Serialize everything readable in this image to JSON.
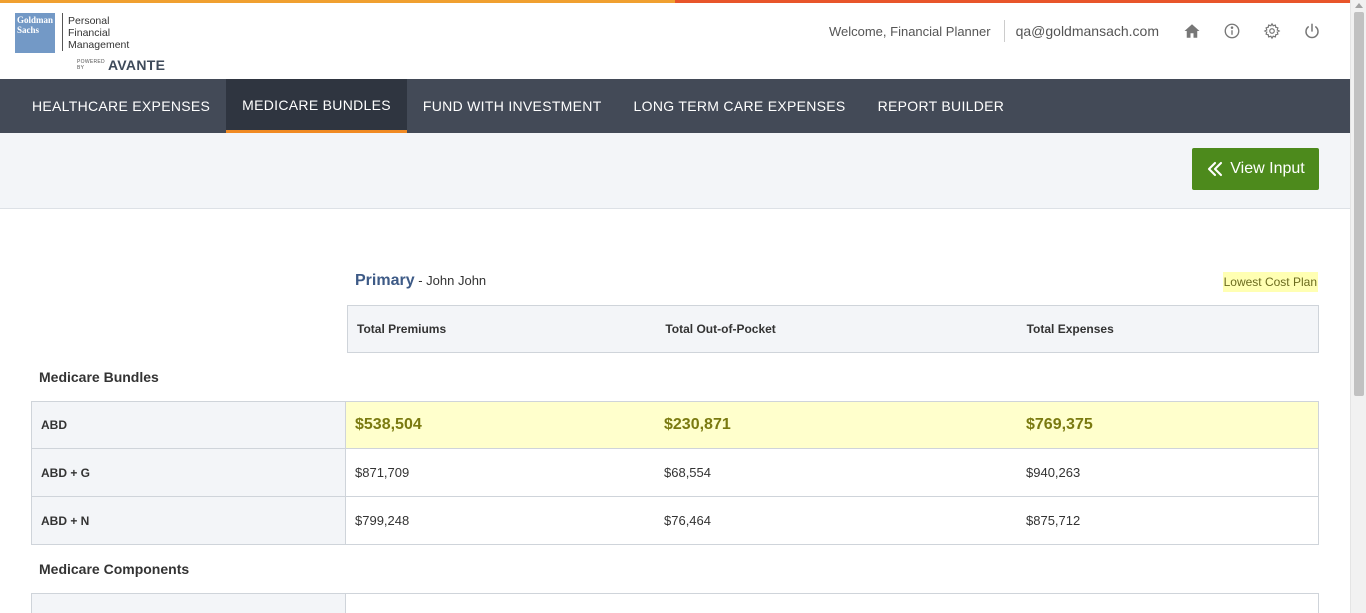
{
  "logo": {
    "gs_line1": "Goldman",
    "gs_line2": "Sachs",
    "pfm_line1": "Personal",
    "pfm_line2": "Financial",
    "pfm_line3": "Management",
    "powered_by": "POWERED BY",
    "avante": "AVANTE"
  },
  "header": {
    "welcome": "Welcome, Financial Planner",
    "email": "qa@goldmansach.com"
  },
  "nav": {
    "items": [
      {
        "label": "HEALTHCARE EXPENSES"
      },
      {
        "label": "MEDICARE BUNDLES"
      },
      {
        "label": "FUND WITH INVESTMENT"
      },
      {
        "label": "LONG TERM CARE EXPENSES"
      },
      {
        "label": "REPORT BUILDER"
      }
    ],
    "active_index": 1
  },
  "toolbar": {
    "view_input_label": "View Input"
  },
  "main": {
    "primary_label": "Primary",
    "primary_name": "- John John",
    "lowest_cost_label": "Lowest Cost Plan",
    "columns": [
      "Total Premiums",
      "Total Out-of-Pocket",
      "Total Expenses"
    ],
    "sections": [
      {
        "title": "Medicare Bundles",
        "rows": [
          {
            "label": "ABD",
            "premiums": "$538,504",
            "oop": "$230,871",
            "total": "$769,375",
            "highlight": true
          },
          {
            "label": "ABD + G",
            "premiums": "$871,709",
            "oop": "$68,554",
            "total": "$940,263"
          },
          {
            "label": "ABD + N",
            "premiums": "$799,248",
            "oop": "$76,464",
            "total": "$875,712"
          }
        ]
      },
      {
        "title": "Medicare Components"
      }
    ]
  },
  "colors": {
    "nav_bg": "#434a57",
    "nav_active_underline": "#f08a24",
    "button_green": "#4d8a1c",
    "highlight_yellow": "#ffffcc",
    "primary_blue": "#3d5a86"
  }
}
